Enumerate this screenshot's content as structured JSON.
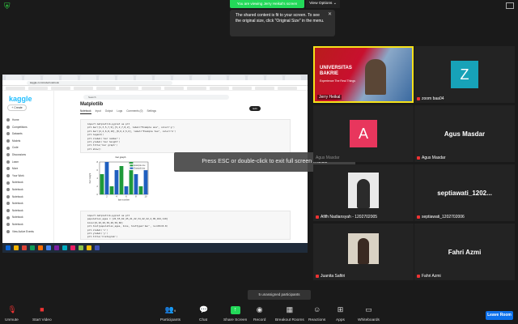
{
  "top": {
    "viewing_banner": "You are viewing Jerry Heikal's screen",
    "view_options": "View Options ⌄",
    "notice": "The shared content is fit to your screen. To see the original size, click \"Original Size\" in the menu."
  },
  "shared_screen": {
    "url": "kaggle.com/code/notebook",
    "kaggle_logo": "kaggle",
    "create_label": "+ Create",
    "sidebar": [
      "Home",
      "Competitions",
      "Datasets",
      "Models",
      "Code",
      "Discussions",
      "Learn",
      "More",
      "Your Work",
      "Notebook",
      "Notebook",
      "Notebook",
      "Notebook",
      "Notebook",
      "Notebook",
      "Notebook",
      "View Active Events"
    ],
    "search_placeholder": "Search",
    "notebook_title": "Matplotlib",
    "notebook_tabs": [
      "Notebook",
      "Input",
      "Output",
      "Logs",
      "Comments (0)",
      "Settings"
    ],
    "edit_label": "Edit",
    "code_cell_1": [
      "import matplotlib.pyplot as plt",
      "plt.bar([1,3,5,7,9],[5,2,7,8,2], label=\"Example one\", color='g')",
      "plt.bar([2,4,6,8,10],[8,6,2,5,6], label=\"Example two\", color='b')",
      "plt.legend()",
      "plt.xlabel('bar number')",
      "plt.ylabel('bar height')",
      "plt.title('bar graph')",
      "plt.show()"
    ],
    "code_cell_2": [
      "import matplotlib.pyplot as plt",
      "population_ages = [22,55,62,45,21,22,34,42,42,4,99,102,110]",
      "bins=[0,10,20,30,40,50,60]",
      "plt.hist(population_ages, bins, histtype='bar', rwidth=0.8)",
      "plt.xlabel('x')",
      "plt.ylabel('y')",
      "plt.title('histogram')"
    ]
  },
  "chart_data": {
    "type": "bar",
    "title": "bar graph",
    "xlabel": "bar number",
    "ylabel": "bar height",
    "series": [
      {
        "name": "Example one",
        "color": "#1e9a3a",
        "x": [
          1,
          3,
          5,
          7,
          9
        ],
        "values": [
          5,
          2,
          7,
          8,
          2
        ]
      },
      {
        "name": "Example two",
        "color": "#1f5fbf",
        "x": [
          2,
          4,
          6,
          8,
          10
        ],
        "values": [
          8,
          6,
          2,
          5,
          6
        ]
      }
    ],
    "ylim": [
      0,
      8
    ]
  },
  "overlay": {
    "esc_message": "Press ESC or double-click to exit full screen mode"
  },
  "participants": [
    {
      "name": "Jerry Heikal",
      "type": "video-banner",
      "banner_title": "UNIVERSITAS BAKRIE",
      "banner_sub": "Experience The Real Things"
    },
    {
      "name": "zoom baa04",
      "type": "letter",
      "letter": "Z",
      "color": "#17a2b8"
    },
    {
      "name": "Agus Masdar",
      "type": "letter",
      "letter": "A",
      "color": "#e8365d"
    },
    {
      "name": "Agus Masdar",
      "type": "name-only",
      "display": "Agus Masdar"
    },
    {
      "name": "Afifh Nadiansyah - 1202702005",
      "type": "video"
    },
    {
      "name": "septiawati_1202702006",
      "type": "name-only",
      "display": "septiawati_1202..."
    },
    {
      "name": "Juanita Safitri",
      "type": "video"
    },
    {
      "name": "Fahri Azmi",
      "type": "name-only",
      "display": "Fahri Azmi"
    }
  ],
  "unassigned": "5 unassigned participants",
  "toolbar": {
    "unmute": "Unmute",
    "start_video": "Start Video",
    "participants": "Participants",
    "participants_count": "9",
    "chat": "Chat",
    "share_screen": "Share Screen",
    "record": "Record",
    "breakout_rooms": "Breakout Rooms",
    "reactions": "Reactions",
    "apps": "Apps",
    "whiteboards": "Whiteboards",
    "leave": "Leave Room"
  }
}
